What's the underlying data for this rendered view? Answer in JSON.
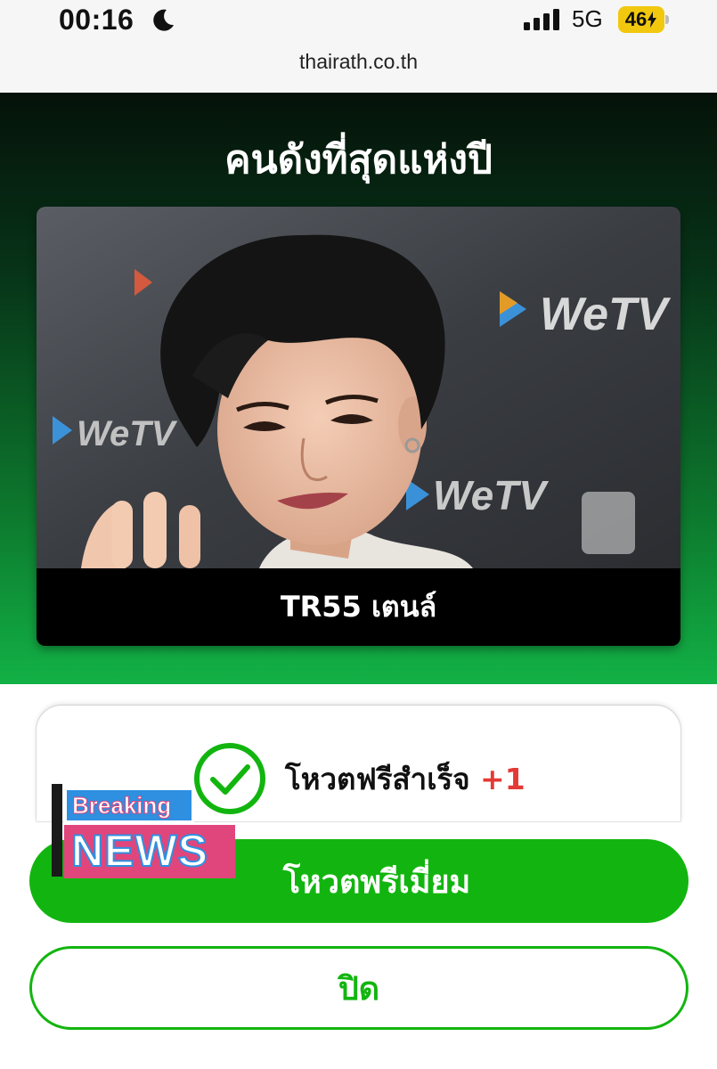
{
  "status_bar": {
    "time": "00:16",
    "network": "5G",
    "battery": "46",
    "icons": [
      "moon-icon",
      "signal-icon",
      "battery-charging-icon"
    ]
  },
  "browser": {
    "url": "thairath.co.th"
  },
  "hero": {
    "title": "คนดังที่สุดแห่งปี",
    "card": {
      "caption": "TR55 เตนล์",
      "photo_backdrop_text": "WeTV"
    }
  },
  "vote_result": {
    "message": "โหวตฟรีสำเร็จ",
    "increment": "+1",
    "icon": "check-circle-icon"
  },
  "buttons": {
    "premium": "โหวตพรีเมี่ยม",
    "close": "ปิด"
  },
  "sticker": {
    "line1": "Breaking",
    "line2": "NEWS"
  },
  "colors": {
    "accent_green": "#12b50f",
    "increment_red": "#e53935",
    "sticker_blue": "#2f8fe0",
    "sticker_pink": "#e0467c"
  }
}
